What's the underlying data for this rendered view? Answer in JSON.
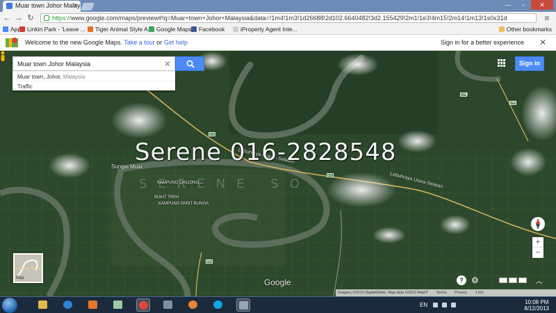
{
  "browser": {
    "tab_title": "Muar town Johor Malaysia",
    "url_scheme": "https://",
    "url_rest": "www.google.com/maps/preview#!q=Muar+town+Johor+Malaysia&data=!1m4!1m3!1d26688!2d102.6640482!3d2.155429!2m1!1e3!4m15!2m14!1m13!1s0x31d",
    "bookmarks": [
      {
        "label": "Apps",
        "color": "#4c8bf5"
      },
      {
        "label": "Linkin Park - 'Leave ...",
        "color": "#d33a2f"
      },
      {
        "label": "Tiger Animal Style A...",
        "color": "#e6732b"
      },
      {
        "label": "Google Maps",
        "color": "#3aa757"
      },
      {
        "label": "Facebook",
        "color": "#3b5998"
      },
      {
        "label": "iProperty Agent Inte...",
        "color": "#cfcfcf"
      }
    ],
    "other_bookmarks": "Other bookmarks"
  },
  "welcome": {
    "message": "Welcome to the new Google Maps.",
    "tour_link": "Take a tour",
    "or": "or",
    "help_link": "Get help",
    "signin_better": "Sign in for a better experience",
    "close": "✕"
  },
  "map": {
    "search_value": "Muar town Johor Malaysia",
    "suggestions": [
      {
        "main": "Muar town, Johor,",
        "sub": "Malaysia"
      },
      {
        "main": "Traffic",
        "sub": ""
      }
    ],
    "signin_label": "Sign in",
    "watermark": "Serene 016-2828548",
    "watermark_sub": "SERENE SO",
    "labels": {
      "sungai_muar": "Sungai Muar",
      "kampung_1": "KAMPUNG TANJONG...",
      "kampung_2": "BUKIT TREH",
      "kampung_3": "KAMPUNG PARIT BUNGA",
      "road_lebuhraya": "Lebuhraya Utara - Selatan",
      "road_lebuhraya_2": "Lebuhraya Utara-Selatan"
    },
    "road_signs": [
      "E2",
      "E2",
      "J40",
      "J41",
      "J141"
    ],
    "google_logo": "Google",
    "help": "?",
    "minimap_label": "Map",
    "zoom_in": "+",
    "zoom_out": "−",
    "attribution": {
      "imagery": "Imagery ©2013 DigitalGlobe, Map data ©2013 MapIT",
      "terms": "Terms",
      "privacy": "Privacy",
      "scale": "1 km"
    }
  },
  "taskbar": {
    "lang": "EN",
    "time": "10:08 PM",
    "date": "8/12/2013",
    "apps": [
      {
        "name": "explorer",
        "color": "#e5b84a",
        "active": false
      },
      {
        "name": "internet-explorer",
        "color": "#2d83d8",
        "active": false
      },
      {
        "name": "media-player",
        "color": "#e7742b",
        "active": false
      },
      {
        "name": "file-manager",
        "color": "#9cc9a0",
        "active": false
      },
      {
        "name": "chrome",
        "color": "#e0463a",
        "active": true
      },
      {
        "name": "network-app",
        "color": "#7a8fa8",
        "active": false
      },
      {
        "name": "firefox",
        "color": "#e9823a",
        "active": false
      },
      {
        "name": "skype",
        "color": "#12a5e3",
        "active": false
      },
      {
        "name": "photos",
        "color": "#95a5b5",
        "active": true
      }
    ]
  }
}
